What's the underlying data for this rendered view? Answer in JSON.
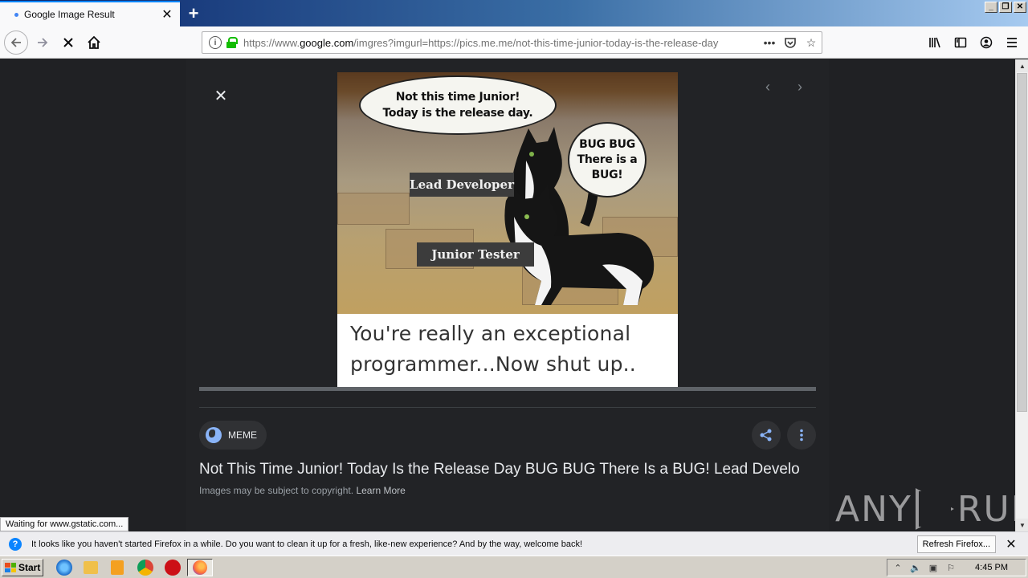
{
  "browser": {
    "tab_title": "Google Image Result",
    "url_prefix": "https://www.",
    "url_domain": "google.com",
    "url_rest": "/imgres?imgurl=https://pics.me.me/not-this-time-junior-today-is-the-release-day",
    "status_text": "Waiting for www.gstatic.com...",
    "url_more": "•••"
  },
  "meme": {
    "bubble_1_line_1": "Not this time Junior!",
    "bubble_1_line_2": "Today is the release day.",
    "bubble_2_line_1": "BUG BUG",
    "bubble_2_line_2": "There is a",
    "bubble_2_line_3": "BUG!",
    "tag_lead": "Lead Developer",
    "tag_junior": "Junior Tester",
    "caption_line_1": "You're really an exceptional",
    "caption_line_2": "programmer...Now shut up.."
  },
  "result": {
    "source": "MEME",
    "title": "Not This Time Junior! Today Is the Release Day BUG BUG There Is a BUG! Lead Develo",
    "copyright": "Images may be subject to copyright.",
    "learn_more": "Learn More"
  },
  "notification": {
    "text": "It looks like you haven't started Firefox in a while. Do you want to clean it up for a fresh, like-new experience? And by the way, welcome back!",
    "button": "Refresh Firefox..."
  },
  "taskbar": {
    "start": "Start",
    "clock": "4:45 PM"
  },
  "watermark": {
    "left": "ANY",
    "right": "RUN"
  },
  "colors": {
    "page_bg": "#202124",
    "accent_blue": "#8ab4f8",
    "tab_highlight": "#0a84ff"
  }
}
